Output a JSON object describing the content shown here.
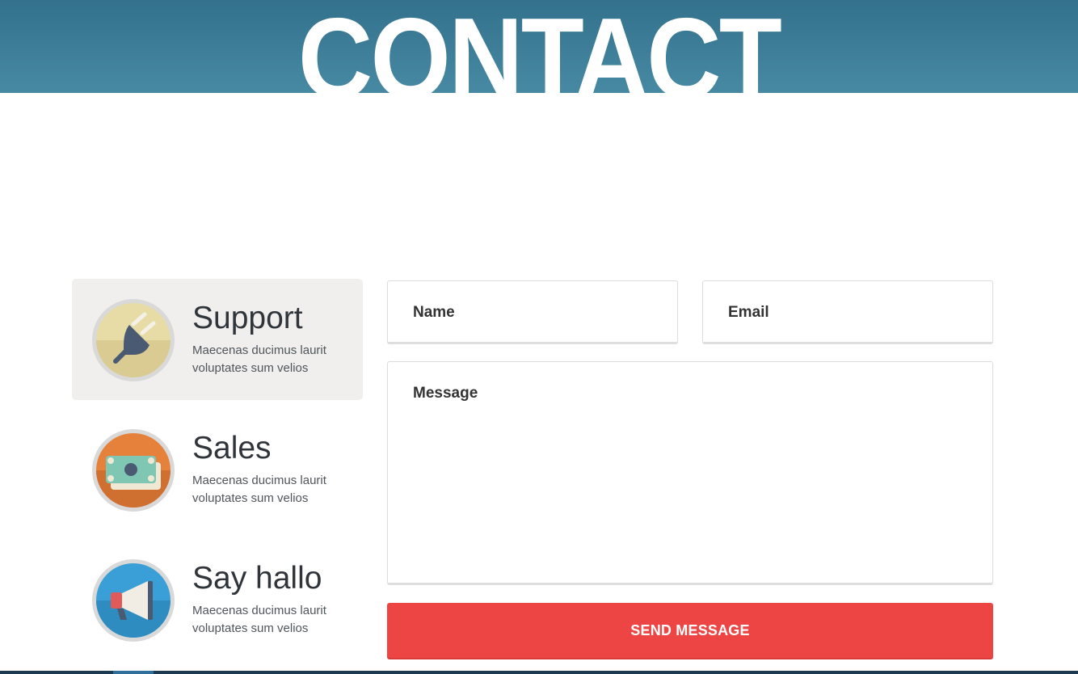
{
  "hero": {
    "title": "CONTACT"
  },
  "channels": [
    {
      "title": "Support",
      "desc": "Maecenas ducimus laurit voluptates sum velios",
      "icon": "plug-icon",
      "active": true
    },
    {
      "title": "Sales",
      "desc": "Maecenas ducimus laurit voluptates sum velios",
      "icon": "money-icon",
      "active": false
    },
    {
      "title": "Say hallo",
      "desc": "Maecenas ducimus laurit voluptates sum velios",
      "icon": "megaphone-icon",
      "active": false
    }
  ],
  "form": {
    "name_placeholder": "Name",
    "email_placeholder": "Email",
    "message_placeholder": "Message",
    "send_label": "SEND MESSAGE"
  },
  "colors": {
    "header": "#3a7d97",
    "accent": "#ed4444",
    "active_card": "#f0efed"
  }
}
